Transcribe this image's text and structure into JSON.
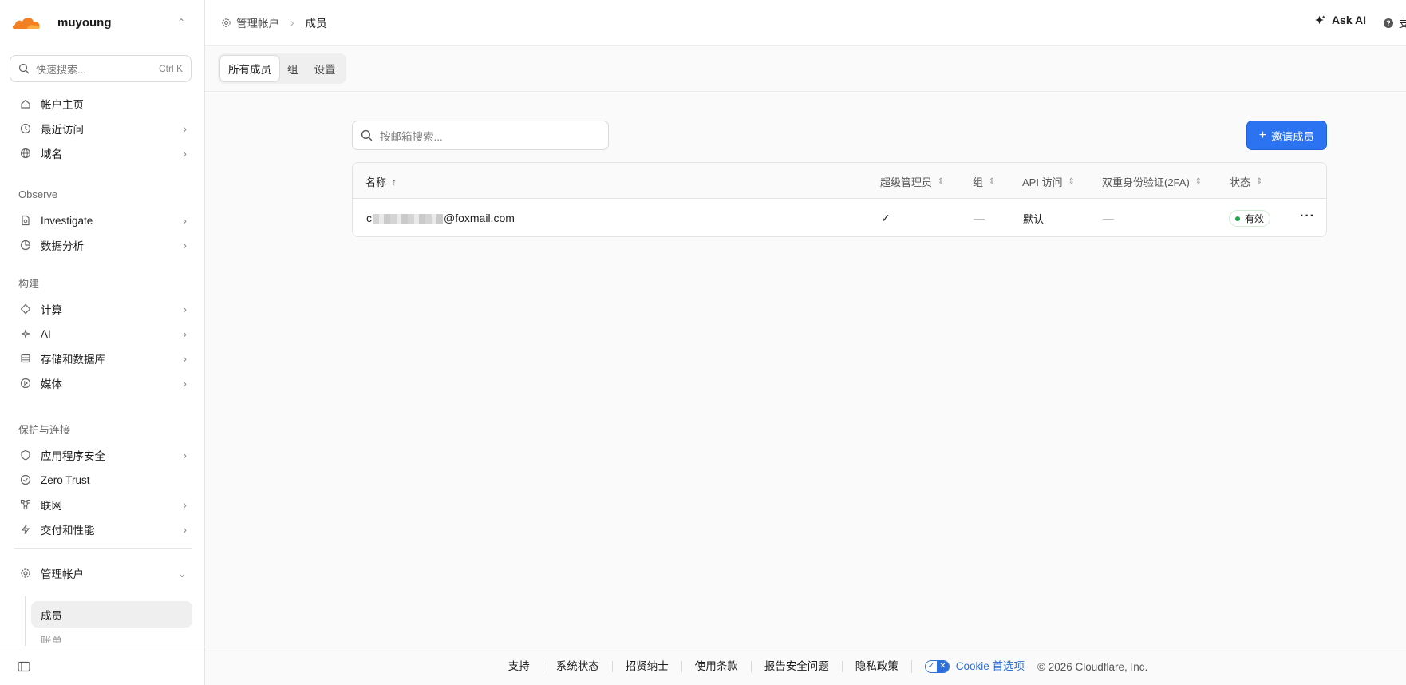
{
  "account": {
    "name": "muyoung"
  },
  "search": {
    "placeholder": "快速搜索...",
    "shortcut": "Ctrl K"
  },
  "sidebar": {
    "items": [
      {
        "label": "帐户主页"
      },
      {
        "label": "最近访问"
      },
      {
        "label": "域名"
      },
      {
        "label": "Investigate"
      },
      {
        "label": "数据分析"
      },
      {
        "label": "计算"
      },
      {
        "label": "AI"
      },
      {
        "label": "存储和数据库"
      },
      {
        "label": "媒体"
      },
      {
        "label": "应用程序安全"
      },
      {
        "label": "Zero Trust"
      },
      {
        "label": "联网"
      },
      {
        "label": "交付和性能"
      },
      {
        "label": "管理帐户"
      }
    ],
    "sections": [
      "Observe",
      "构建",
      "保护与连接"
    ],
    "subitems": [
      {
        "label": "成员"
      },
      {
        "label": "账单"
      }
    ]
  },
  "breadcrumb": {
    "parent": "管理帐户",
    "current": "成员"
  },
  "header": {
    "ask_ai": "Ask AI",
    "support": "支"
  },
  "tabs": [
    {
      "label": "所有成员"
    },
    {
      "label": "组"
    },
    {
      "label": "设置"
    }
  ],
  "members": {
    "search_placeholder": "按邮箱搜索...",
    "invite_label": "邀请成员",
    "columns": [
      "名称",
      "超级管理员",
      "组",
      "API 访问",
      "双重身份验证(2FA)",
      "状态"
    ],
    "rows": [
      {
        "email_prefix": "c",
        "email_suffix": "@foxmail.com",
        "super_admin": "✓",
        "groups": "—",
        "api_access": "默认",
        "two_fa": "—",
        "status": "有效"
      }
    ]
  },
  "footer": {
    "links": [
      "支持",
      "系统状态",
      "招贤纳士",
      "使用条款",
      "报告安全问题",
      "隐私政策"
    ],
    "cookie": "Cookie 首选项",
    "copyright": "© 2026 Cloudflare, Inc."
  },
  "colors": {
    "accent": "#2b73f0",
    "brand": "#f38020",
    "status_ok": "#1fa64a"
  }
}
